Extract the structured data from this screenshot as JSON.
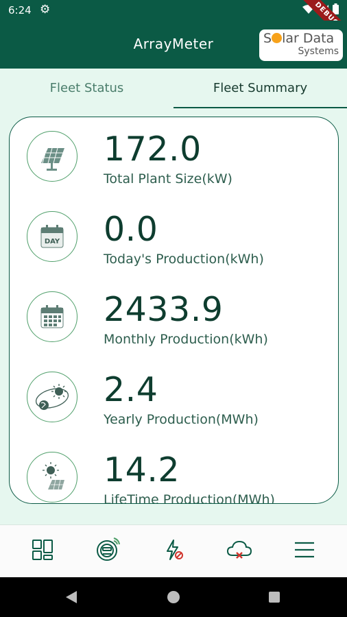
{
  "status_bar": {
    "time": "6:24",
    "settings_icon": "gear-icon",
    "debug_label": "DEBUG"
  },
  "app_bar": {
    "title": "ArrayMeter",
    "logo_line1_a": "S",
    "logo_line1_b": "lar Data",
    "logo_line2": "Systems"
  },
  "tabs": [
    {
      "label": "Fleet Status",
      "active": false
    },
    {
      "label": "Fleet Summary",
      "active": true
    }
  ],
  "metrics": [
    {
      "value": "172.0",
      "label": "Total Plant Size(kW)",
      "icon": "solar-panel-icon"
    },
    {
      "value": "0.0",
      "label": "Today's Production(kWh)",
      "icon": "day-calendar-icon"
    },
    {
      "value": "2433.9",
      "label": "Monthly Production(kWh)",
      "icon": "month-calendar-icon"
    },
    {
      "value": "2.4",
      "label": "Yearly Production(MWh)",
      "icon": "sun-earth-orbit-icon"
    },
    {
      "value": "14.2",
      "label": "LifeTime Production(MWh)",
      "icon": "sun-panel-icon"
    }
  ],
  "day_icon_text": "DAY",
  "bottom_nav": [
    "dashboard-icon",
    "meter-icon",
    "no-power-icon",
    "cloud-offline-icon",
    "menu-icon"
  ],
  "colors": {
    "primary": "#0b5a45",
    "background": "#e6f7ef",
    "accent_green": "#4f9f6a",
    "alert_red": "#d0342c",
    "logo_sun": "#f7a21b"
  }
}
